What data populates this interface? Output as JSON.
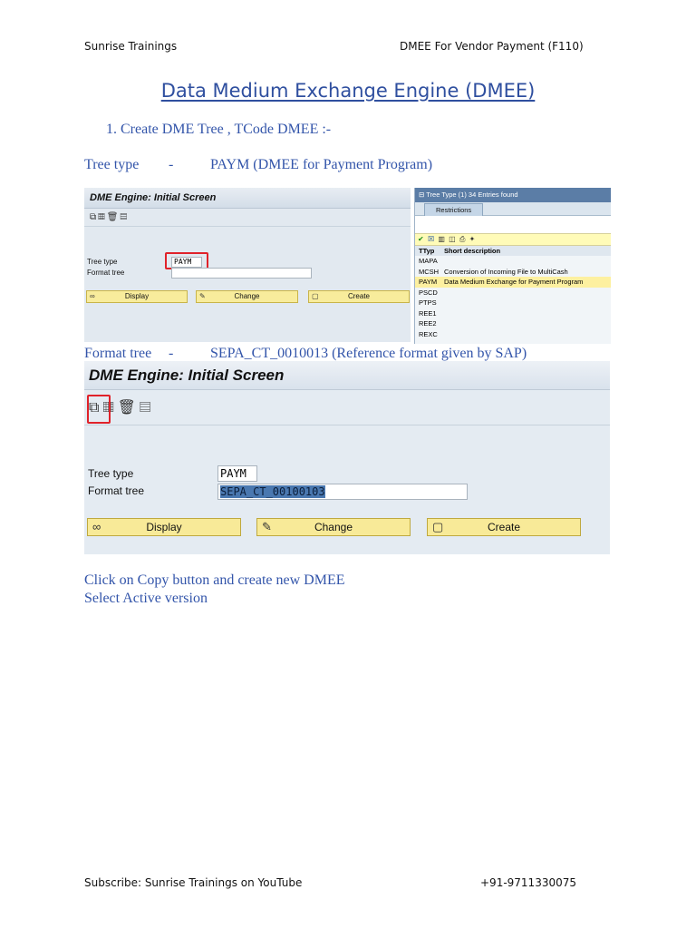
{
  "header": {
    "left": "Sunrise Trainings",
    "right": "DMEE For Vendor Payment (F110)"
  },
  "title": "Data Medium Exchange Engine (DMEE)",
  "step1": "1.  Create DME Tree , TCode DMEE :-",
  "tree_type_line": {
    "label": "Tree type",
    "dash": "-",
    "value": "PAYM (DMEE for Payment Program)"
  },
  "screen1": {
    "title": "DME Engine: Initial Screen",
    "labels": {
      "tree_type": "Tree type",
      "format_tree": "Format tree"
    },
    "tree_type_value": "PAYM",
    "buttons": {
      "display": "Display",
      "change": "Change",
      "create": "Create"
    }
  },
  "popup": {
    "title": "Tree Type (1)   34 Entries found",
    "tab": "Restrictions",
    "columns": [
      "TTyp",
      "Short description"
    ],
    "rows": [
      {
        "code": "MAPA",
        "desc": ""
      },
      {
        "code": "MCSH",
        "desc": "Conversion of Incoming File to MultiCash"
      },
      {
        "code": "PAYM",
        "desc": "Data Medium Exchange for Payment Program"
      },
      {
        "code": "PSCD",
        "desc": ""
      },
      {
        "code": "PTPS",
        "desc": ""
      },
      {
        "code": "REE1",
        "desc": ""
      },
      {
        "code": "REE2",
        "desc": ""
      },
      {
        "code": "REXC",
        "desc": ""
      }
    ]
  },
  "format_tree_line": {
    "label": "Format tree",
    "dash": "-",
    "value": "SEPA_CT_0010013 (Reference format given by SAP)"
  },
  "screen2": {
    "title": "DME Engine: Initial Screen",
    "labels": {
      "tree_type": "Tree type",
      "format_tree": "Format tree"
    },
    "tree_type_value": "PAYM",
    "format_tree_value": "SEPA_CT_00100103",
    "buttons": {
      "display": "Display",
      "change": "Change",
      "create": "Create"
    }
  },
  "notes": [
    "Click on Copy button and create new DMEE",
    "Select Active version"
  ],
  "footer": {
    "left": "Subscribe: Sunrise Trainings on YouTube",
    "right": "+91-9711330075"
  }
}
